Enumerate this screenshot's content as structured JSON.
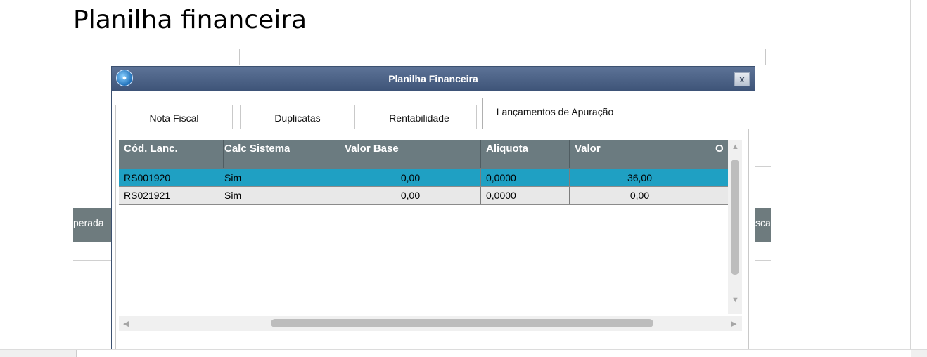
{
  "document": {
    "title": "Planilha financeira"
  },
  "background_app": {
    "strip_left": "perada",
    "strip_right": "sca"
  },
  "dialog": {
    "title": "Planilha Financeira",
    "close_label": "x",
    "tabs": [
      {
        "label": "Nota Fiscal"
      },
      {
        "label": "Duplicatas"
      },
      {
        "label": "Rentabilidade"
      },
      {
        "label": "Lançamentos de Apuração",
        "active": true
      }
    ],
    "grid": {
      "columns": [
        "Cód. Lanc.",
        "Calc Sistema",
        "Valor Base",
        "Aliquota",
        "Valor",
        "O"
      ],
      "rows": [
        {
          "cod": "RS001920",
          "calc": "Sim",
          "base": "0,00",
          "aliquota": "0,0000",
          "valor": "36,00",
          "selected": true
        },
        {
          "cod": "RS021921",
          "calc": "Sim",
          "base": "0,00",
          "aliquota": "0,0000",
          "valor": "0,00",
          "selected": false
        }
      ]
    }
  },
  "icons": {
    "app": "app-logo-icon",
    "close": "close-icon",
    "scroll_up": "triangle-up-icon",
    "scroll_down": "triangle-down-icon",
    "scroll_left": "triangle-left-icon",
    "scroll_right": "triangle-right-icon"
  },
  "colors": {
    "titlebar": "#3e5478",
    "grid_header": "#6b7b80",
    "selected_row": "#1fa0c3"
  }
}
